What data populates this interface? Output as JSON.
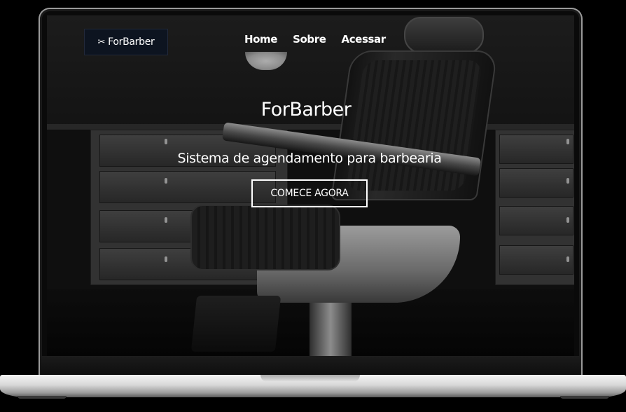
{
  "brand": {
    "icon": "scissors-icon",
    "name": "ForBarber"
  },
  "nav": {
    "items": [
      {
        "label": "Home"
      },
      {
        "label": "Sobre"
      },
      {
        "label": "Acessar"
      }
    ]
  },
  "hero": {
    "title": "ForBarber",
    "subtitle": "Sistema de agendamento para barbearia",
    "cta_label": "COMECE AGORA"
  },
  "colors": {
    "brand_bg": "#0d1420",
    "text": "#ffffff",
    "page_bg": "#000000"
  }
}
